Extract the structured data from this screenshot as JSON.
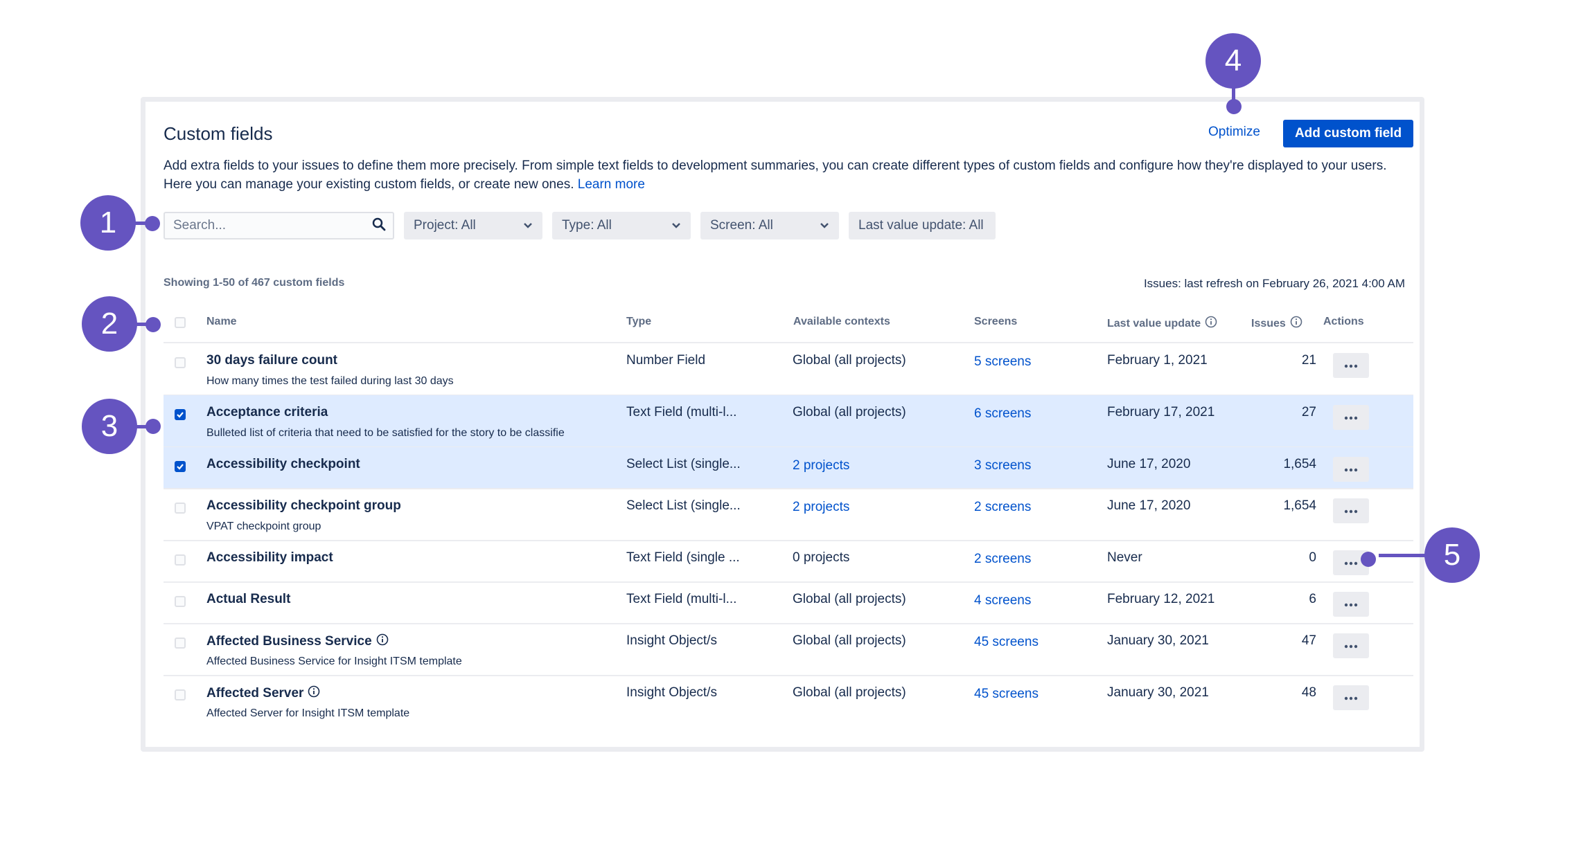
{
  "page": {
    "title": "Custom fields",
    "description": "Add extra fields to your issues to define them more precisely. From simple text fields to development summaries, you can create different types of custom fields and configure how they're displayed to your users. Here you can manage your existing custom fields, or create new ones.",
    "learn_more": "Learn more",
    "optimize": "Optimize",
    "add_button": "Add custom field"
  },
  "filters": {
    "search_placeholder": "Search...",
    "project": "Project: All",
    "type": "Type: All",
    "screen": "Screen: All",
    "last_value": "Last value update: All"
  },
  "summary": {
    "showing": "Showing 1-50 of 467 custom fields",
    "refresh": "Issues: last refresh on February 26, 2021 4:00 AM"
  },
  "columns": {
    "name": "Name",
    "type": "Type",
    "contexts": "Available contexts",
    "screens": "Screens",
    "last_value": "Last value update",
    "issues": "Issues",
    "actions": "Actions"
  },
  "rows": [
    {
      "name": "30 days failure count",
      "description": "How many times the test failed during last 30 days",
      "type": "Number Field",
      "contexts": "Global (all projects)",
      "screens": "5 screens",
      "last_value": "February 1, 2021",
      "issues": "21",
      "checked": false
    },
    {
      "name": "Acceptance criteria",
      "description": "Bulleted list of criteria that need to be satisfied for the story to be classifie",
      "type": "Text Field (multi-l...",
      "contexts": "Global (all projects)",
      "screens": "6 screens",
      "last_value": "February 17, 2021",
      "issues": "27",
      "checked": true
    },
    {
      "name": "Accessibility checkpoint",
      "description": "",
      "type": "Select List (single...",
      "contexts": "2 projects",
      "screens": "3 screens",
      "last_value": "June 17, 2020",
      "issues": "1,654",
      "checked": true
    },
    {
      "name": "Accessibility checkpoint group",
      "description": "VPAT checkpoint group",
      "type": "Select List (single...",
      "contexts": "2 projects",
      "screens": "2 screens",
      "last_value": "June 17, 2020",
      "issues": "1,654",
      "checked": false
    },
    {
      "name": "Accessibility impact",
      "description": "",
      "type": "Text Field (single ...",
      "contexts": "0 projects",
      "screens": "2 screens",
      "last_value": "Never",
      "issues": "0",
      "checked": false
    },
    {
      "name": "Actual Result",
      "description": "",
      "type": "Text Field (multi-l...",
      "contexts": "Global (all projects)",
      "screens": "4 screens",
      "last_value": "February 12, 2021",
      "issues": "6",
      "checked": false
    },
    {
      "name": "Affected Business Service",
      "description": "Affected Business Service for Insight ITSM template",
      "type": "Insight Object/s",
      "contexts": "Global (all projects)",
      "screens": "45 screens",
      "last_value": "January 30, 2021",
      "issues": "47",
      "checked": false
    },
    {
      "name": "Affected Server",
      "description": "Affected Server for Insight ITSM template",
      "type": "Insight Object/s",
      "contexts": "Global (all projects)",
      "screens": "45 screens",
      "last_value": "January 30, 2021",
      "issues": "48",
      "checked": false
    }
  ],
  "callouts": {
    "one": "1",
    "two": "2",
    "three": "3",
    "four": "4",
    "five": "5"
  },
  "colors": {
    "accent": "#0052cc",
    "callout": "#6554c0",
    "selected_row": "#deebff"
  }
}
